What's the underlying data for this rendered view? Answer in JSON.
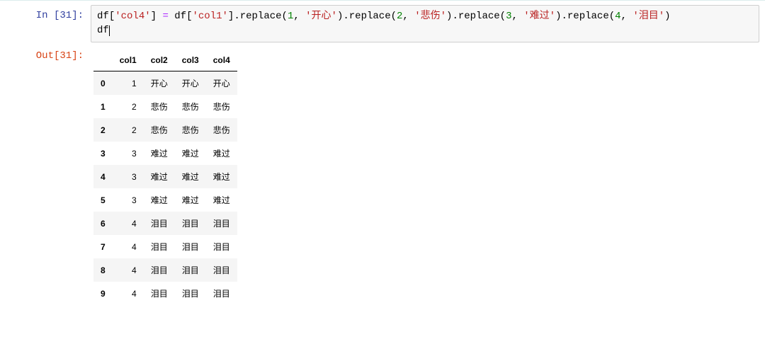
{
  "cell": {
    "exec_count": 31,
    "in_prefix": "In  [",
    "in_suffix": "]:",
    "out_prefix": "Out[",
    "out_suffix": "]:",
    "code_tokens": [
      {
        "t": "var",
        "s": "df"
      },
      {
        "t": "punc",
        "s": "["
      },
      {
        "t": "str",
        "s": "'col4'"
      },
      {
        "t": "punc",
        "s": "] "
      },
      {
        "t": "op",
        "s": "="
      },
      {
        "t": "punc",
        "s": " "
      },
      {
        "t": "var",
        "s": "df"
      },
      {
        "t": "punc",
        "s": "["
      },
      {
        "t": "str",
        "s": "'col1'"
      },
      {
        "t": "punc",
        "s": "]"
      },
      {
        "t": "punc",
        "s": "."
      },
      {
        "t": "var",
        "s": "replace"
      },
      {
        "t": "punc",
        "s": "("
      },
      {
        "t": "num",
        "s": "1"
      },
      {
        "t": "punc",
        "s": ", "
      },
      {
        "t": "str",
        "s": "'开心'"
      },
      {
        "t": "punc",
        "s": ")"
      },
      {
        "t": "punc",
        "s": "."
      },
      {
        "t": "var",
        "s": "replace"
      },
      {
        "t": "punc",
        "s": "("
      },
      {
        "t": "num",
        "s": "2"
      },
      {
        "t": "punc",
        "s": ", "
      },
      {
        "t": "str",
        "s": "'悲伤'"
      },
      {
        "t": "punc",
        "s": ")"
      },
      {
        "t": "punc",
        "s": "."
      },
      {
        "t": "var",
        "s": "replace"
      },
      {
        "t": "punc",
        "s": "("
      },
      {
        "t": "num",
        "s": "3"
      },
      {
        "t": "punc",
        "s": ", "
      },
      {
        "t": "str",
        "s": "'难过'"
      },
      {
        "t": "punc",
        "s": ")"
      },
      {
        "t": "punc",
        "s": "."
      },
      {
        "t": "var",
        "s": "replace"
      },
      {
        "t": "punc",
        "s": "("
      },
      {
        "t": "num",
        "s": "4"
      },
      {
        "t": "punc",
        "s": ", "
      },
      {
        "t": "str",
        "s": "'泪目'"
      },
      {
        "t": "punc",
        "s": ")"
      },
      {
        "t": "nl",
        "s": ""
      },
      {
        "t": "var",
        "s": "df"
      }
    ],
    "output_table": {
      "columns": [
        "col1",
        "col2",
        "col3",
        "col4"
      ],
      "rows": [
        {
          "idx": "0",
          "cells": [
            "1",
            "开心",
            "开心",
            "开心"
          ]
        },
        {
          "idx": "1",
          "cells": [
            "2",
            "悲伤",
            "悲伤",
            "悲伤"
          ]
        },
        {
          "idx": "2",
          "cells": [
            "2",
            "悲伤",
            "悲伤",
            "悲伤"
          ]
        },
        {
          "idx": "3",
          "cells": [
            "3",
            "难过",
            "难过",
            "难过"
          ]
        },
        {
          "idx": "4",
          "cells": [
            "3",
            "难过",
            "难过",
            "难过"
          ]
        },
        {
          "idx": "5",
          "cells": [
            "3",
            "难过",
            "难过",
            "难过"
          ]
        },
        {
          "idx": "6",
          "cells": [
            "4",
            "泪目",
            "泪目",
            "泪目"
          ]
        },
        {
          "idx": "7",
          "cells": [
            "4",
            "泪目",
            "泪目",
            "泪目"
          ]
        },
        {
          "idx": "8",
          "cells": [
            "4",
            "泪目",
            "泪目",
            "泪目"
          ]
        },
        {
          "idx": "9",
          "cells": [
            "4",
            "泪目",
            "泪目",
            "泪目"
          ]
        }
      ]
    }
  }
}
